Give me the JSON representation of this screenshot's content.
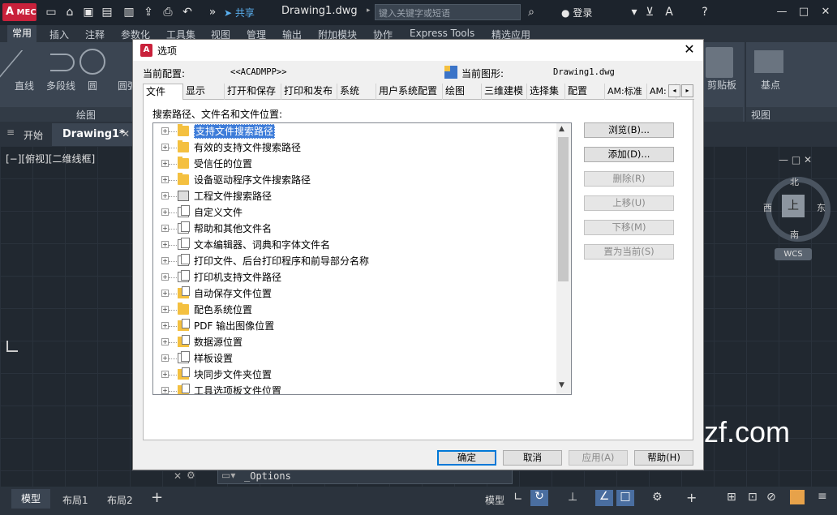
{
  "app": {
    "logo": "A",
    "logo_sub": "MEC",
    "share_label": "共享",
    "document_title": "Drawing1.dwg",
    "search_placeholder": "键入关键字或短语",
    "login_label": "登录"
  },
  "ribbon": {
    "tabs": [
      "常用",
      "插入",
      "注释",
      "参数化",
      "工具集",
      "视图",
      "管理",
      "输出",
      "附加模块",
      "协作",
      "Express Tools",
      "精选应用"
    ],
    "active_tab": "常用",
    "tools": [
      "直线",
      "多段线",
      "圆",
      "圆弧"
    ],
    "group_draw": "绘图",
    "group_view": "视图",
    "clipboard_label": "剪贴板",
    "base_label": "基点"
  },
  "doc_tabs": {
    "start": "开始",
    "drawing": "Drawing1*"
  },
  "viewport": {
    "label": "[−][俯视][二维线框]"
  },
  "viewcube": {
    "north": "北",
    "south": "南",
    "east": "东",
    "west": "西",
    "face": "上",
    "wcs": "WCS"
  },
  "watermark": "zf.com",
  "command_line": "_Options",
  "status_bar": {
    "tabs": [
      "模型",
      "布局1",
      "布局2"
    ],
    "plus": "+",
    "mode": "模型"
  },
  "dialog": {
    "title": "选项",
    "current_profile_label": "当前配置:",
    "current_profile_value": "<<ACADMPP>>",
    "current_drawing_label": "当前图形:",
    "current_drawing_value": "Drawing1.dwg",
    "tabs": [
      "文件",
      "显示",
      "打开和保存",
      "打印和发布",
      "系统",
      "用户系统配置",
      "绘图",
      "三维建模",
      "选择集",
      "配置",
      "AM:标准",
      "AM:结"
    ],
    "active_tab": "文件",
    "section_label": "搜索路径、文件名和文件位置:",
    "tree_items": [
      {
        "label": "支持文件搜索路径",
        "icon": "folder-icon",
        "selected": true
      },
      {
        "label": "有效的支持文件搜索路径",
        "icon": "folder-icon"
      },
      {
        "label": "受信任的位置",
        "icon": "folder-icon"
      },
      {
        "label": "设备驱动程序文件搜索路径",
        "icon": "folder-icon"
      },
      {
        "label": "工程文件搜索路径",
        "icon": "server-icon"
      },
      {
        "label": "自定义文件",
        "icon": "pages-icon"
      },
      {
        "label": "帮助和其他文件名",
        "icon": "pages-icon"
      },
      {
        "label": "文本编辑器、词典和字体文件名",
        "icon": "pages-icon"
      },
      {
        "label": "打印文件、后台打印程序和前导部分名称",
        "icon": "pages-icon"
      },
      {
        "label": "打印机支持文件路径",
        "icon": "pages-icon"
      },
      {
        "label": "自动保存文件位置",
        "icon": "folder-page-icon"
      },
      {
        "label": "配色系统位置",
        "icon": "folder-icon"
      },
      {
        "label": "PDF 输出图像位置",
        "icon": "folder-page-icon"
      },
      {
        "label": "数据源位置",
        "icon": "folder-page-icon"
      },
      {
        "label": "样板设置",
        "icon": "pages-icon"
      },
      {
        "label": "块同步文件夹位置",
        "icon": "folder-page-icon"
      },
      {
        "label": "工具选项板文件位置",
        "icon": "folder-page-icon"
      }
    ],
    "side_buttons": [
      {
        "label": "浏览(B)...",
        "enabled": true
      },
      {
        "label": "添加(D)...",
        "enabled": true
      },
      {
        "label": "删除(R)",
        "enabled": false
      },
      {
        "label": "上移(U)",
        "enabled": false
      },
      {
        "label": "下移(M)",
        "enabled": false
      },
      {
        "label": "置为当前(S)",
        "enabled": false
      }
    ],
    "footer_buttons": {
      "ok": "确定",
      "cancel": "取消",
      "apply": "应用(A)",
      "help": "帮助(H)"
    }
  },
  "colors": {
    "accent": "#0078d7",
    "selection": "#3d7cd9",
    "brand": "#c9213b",
    "folder": "#f4c040"
  }
}
